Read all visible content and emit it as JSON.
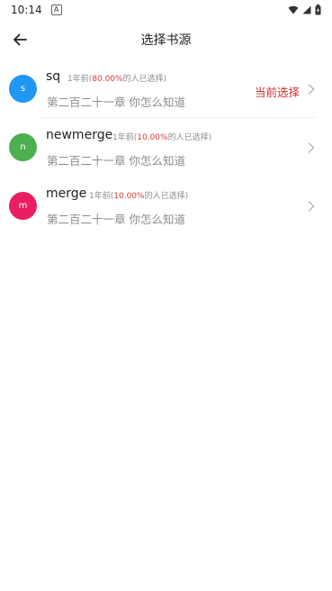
{
  "status_bar": {
    "time": "10:14",
    "notification_icon": "a-icon",
    "icons": [
      "wifi-icon",
      "signal-icon",
      "battery-icon"
    ]
  },
  "header": {
    "title": "选择书源",
    "back_icon": "arrow-left-icon"
  },
  "colors": {
    "accent_red": "#d32f2f",
    "percent_red": "#d93a3a",
    "secondary_text": "#8c8c8c"
  },
  "sources": [
    {
      "avatar_letter": "s",
      "avatar_color": "#2196f3",
      "name": "sq",
      "meta_prefix": "1年前(",
      "percent": "80.00%",
      "meta_suffix": "的人已选择)",
      "chapter": "第二百二十一章 你怎么知道",
      "current_label": "当前选择"
    },
    {
      "avatar_letter": "n",
      "avatar_color": "#4caf50",
      "name": "newmerge",
      "meta_prefix": "1年前(",
      "percent": "10.00%",
      "meta_suffix": "的人已选择)",
      "chapter": "第二百二十一章 你怎么知道",
      "current_label": ""
    },
    {
      "avatar_letter": "m",
      "avatar_color": "#e91e63",
      "name": "merge",
      "meta_prefix": "1年前(",
      "percent": "10.00%",
      "meta_suffix": "的人已选择)",
      "chapter": "第二百二十一章 你怎么知道",
      "current_label": ""
    }
  ]
}
